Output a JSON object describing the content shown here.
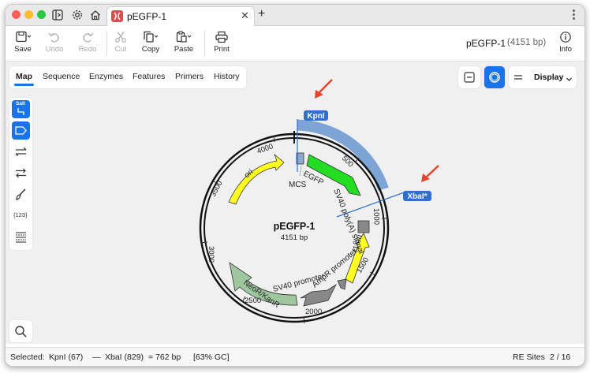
{
  "tab": {
    "title": "pEGFP-1"
  },
  "toolbar": {
    "save": "Save",
    "undo": "Undo",
    "redo": "Redo",
    "cut": "Cut",
    "copy": "Copy",
    "paste": "Paste",
    "print": "Print",
    "info": "Info"
  },
  "document": {
    "name": "pEGFP-1",
    "size": "(4151 bp)"
  },
  "view_tabs": [
    "Map",
    "Sequence",
    "Enzymes",
    "Features",
    "Primers",
    "History"
  ],
  "active_view_tab": "Map",
  "display_label": "Display",
  "sidebar": {
    "enzyme_icon_text": "SalI",
    "number_text": "{123}"
  },
  "map": {
    "name": "pEGFP-1",
    "length": "4151 bp",
    "ticks": [
      "500",
      "1000",
      "1500",
      "2000",
      "2500",
      "3000",
      "3500",
      "4000"
    ],
    "enzymes": [
      {
        "name": "KpnI",
        "position": 67
      },
      {
        "name": "XbaI*",
        "position": 829
      }
    ],
    "features": [
      {
        "name": "EGFP",
        "color": "#22dd22"
      },
      {
        "name": "MCS",
        "color": "#8fa7cc"
      },
      {
        "name": "SV40 poly(A) signal",
        "color": "#888888"
      },
      {
        "name": "f1 ori",
        "color": "#ffff22"
      },
      {
        "name": "AmpR promoter",
        "color": "#888888"
      },
      {
        "name": "SV40 promoter",
        "color": "#888888"
      },
      {
        "name": "NeoR/KanR",
        "color": "#9fc79f"
      },
      {
        "name": "ori",
        "color": "#ffff22"
      }
    ],
    "selection_color": "#6f9bd0",
    "enzyme_label_color": "#2f6fd0"
  },
  "status": {
    "selected_label": "Selected:",
    "start": "KpnI (67)",
    "dash": "—",
    "end": "XbaI (829)",
    "equals": "= 762 bp",
    "gc": "[63% GC]",
    "re_sites": "RE Sites",
    "page": "2 / 16"
  },
  "accent_color": "#1a73e8",
  "annotation_arrow_color": "#e4442b"
}
